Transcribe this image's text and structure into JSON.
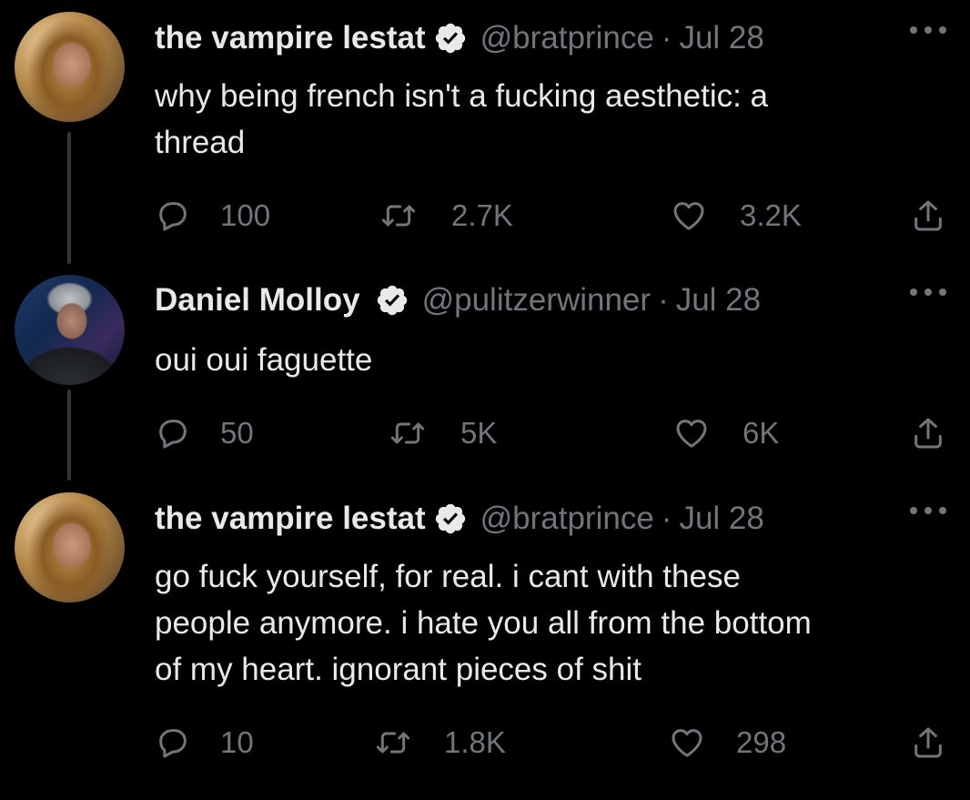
{
  "tweets": [
    {
      "name": "the vampire lestat",
      "handle": "@bratprince",
      "separator": "·",
      "date": "Jul 28",
      "text": "why being french isn't a fucking aesthetic: a\nthread",
      "replies": "100",
      "retweets": "2.7K",
      "likes": "3.2K"
    },
    {
      "name": "Daniel Molloy",
      "handle": "@pulitzerwinner",
      "separator": "·",
      "date": "Jul 28",
      "text": "oui oui faguette",
      "replies": "50",
      "retweets": "5K",
      "likes": "6K"
    },
    {
      "name": "the vampire lestat",
      "handle": "@bratprince",
      "separator": "·",
      "date": "Jul 28",
      "text": "go fuck yourself, for real. i cant with these\npeople anymore. i hate you all from the bottom\nof my heart. ignorant pieces of shit",
      "replies": "10",
      "retweets": "1.8K",
      "likes": "298"
    }
  ],
  "icons": {
    "reply": "speech-bubble-icon",
    "retweet": "retweet-icon",
    "like": "heart-icon",
    "share": "share-icon",
    "verified": "verified-badge-icon",
    "more": "more-options-icon"
  },
  "colors": {
    "background": "#000000",
    "text": "#e7e9ea",
    "muted": "#71767b",
    "verified_badge": "#e7e9ea"
  }
}
